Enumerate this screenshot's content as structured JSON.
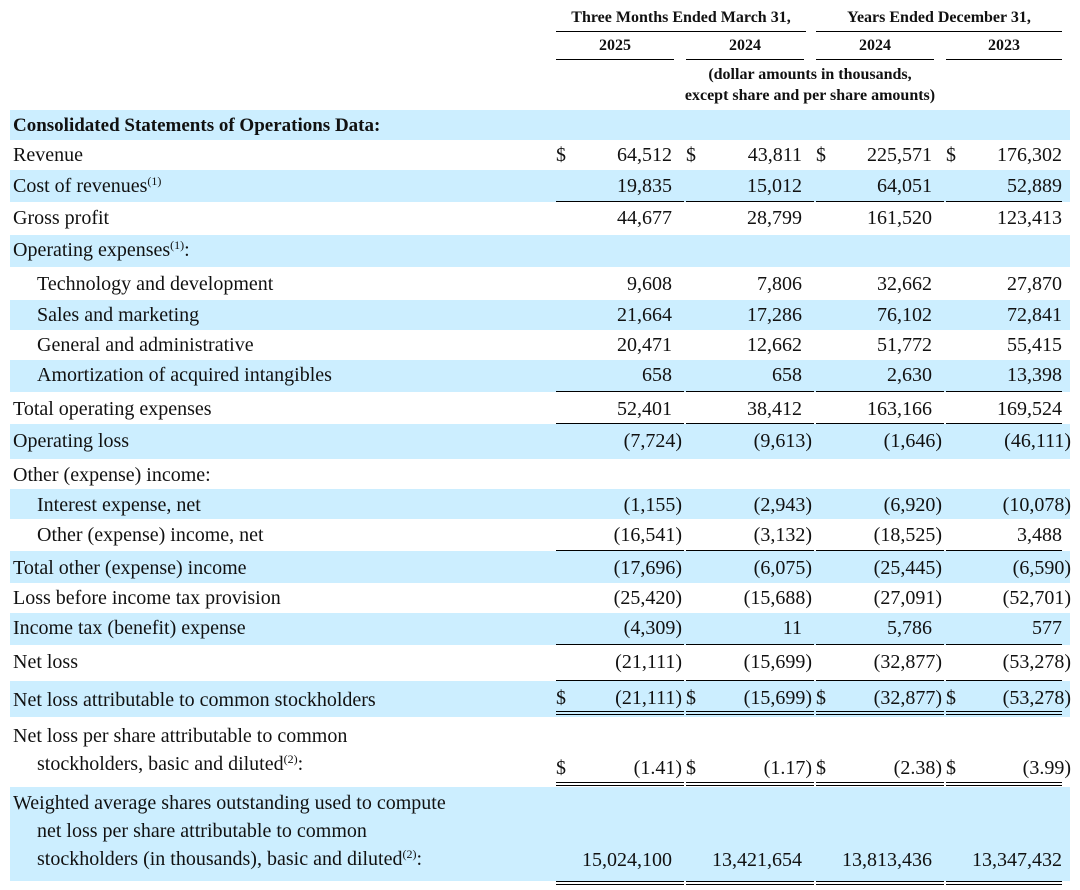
{
  "header": {
    "group1": "Three Months Ended March 31,",
    "group2": "Years Ended December 31,",
    "years": [
      "2025",
      "2024",
      "2024",
      "2023"
    ],
    "note_line1": "(dollar amounts in thousands,",
    "note_line2": "except share and per share amounts)"
  },
  "section_title": "Consolidated Statements of Operations Data:",
  "currency_symbol": "$",
  "footnotes": {
    "one": "(1)",
    "two": "(2)"
  },
  "rows": {
    "revenue": {
      "label": "Revenue",
      "values": [
        "64,512",
        "43,811",
        "225,571",
        "176,302"
      ]
    },
    "cost_of_revenues": {
      "label": "Cost of revenues",
      "values": [
        "19,835",
        "15,012",
        "64,051",
        "52,889"
      ]
    },
    "gross_profit": {
      "label": "Gross profit",
      "values": [
        "44,677",
        "28,799",
        "161,520",
        "123,413"
      ]
    },
    "operating_expenses": {
      "label": "Operating expenses",
      "suffix": ":"
    },
    "tech_dev": {
      "label": "Technology and development",
      "values": [
        "9,608",
        "7,806",
        "32,662",
        "27,870"
      ]
    },
    "sales_marketing": {
      "label": "Sales and marketing",
      "values": [
        "21,664",
        "17,286",
        "76,102",
        "72,841"
      ]
    },
    "general_admin": {
      "label": "General and administrative",
      "values": [
        "20,471",
        "12,662",
        "51,772",
        "55,415"
      ]
    },
    "amortization": {
      "label": "Amortization of acquired intangibles",
      "values": [
        "658",
        "658",
        "2,630",
        "13,398"
      ]
    },
    "total_opex": {
      "label": "Total operating expenses",
      "values": [
        "52,401",
        "38,412",
        "163,166",
        "169,524"
      ]
    },
    "operating_loss": {
      "label": "Operating loss",
      "values": [
        "(7,724)",
        "(9,613)",
        "(1,646)",
        "(46,111)"
      ]
    },
    "other_income": {
      "label": "Other (expense) income:"
    },
    "interest_expense": {
      "label": "Interest expense, net",
      "values": [
        "(1,155)",
        "(2,943)",
        "(6,920)",
        "(10,078)"
      ]
    },
    "other_exp_income": {
      "label": "Other (expense) income, net",
      "values": [
        "(16,541)",
        "(3,132)",
        "(18,525)",
        "3,488"
      ]
    },
    "total_other": {
      "label": "Total other (expense) income",
      "values": [
        "(17,696)",
        "(6,075)",
        "(25,445)",
        "(6,590)"
      ]
    },
    "loss_before_tax": {
      "label": "Loss before income tax provision",
      "values": [
        "(25,420)",
        "(15,688)",
        "(27,091)",
        "(52,701)"
      ]
    },
    "income_tax": {
      "label": "Income tax (benefit) expense",
      "values": [
        "(4,309)",
        "11",
        "5,786",
        "577"
      ]
    },
    "net_loss": {
      "label": "Net loss",
      "values": [
        "(21,111)",
        "(15,699)",
        "(32,877)",
        "(53,278)"
      ]
    },
    "net_loss_common": {
      "label": "Net loss attributable to common stockholders",
      "values": [
        "(21,111)",
        "(15,699)",
        "(32,877)",
        "(53,278)"
      ]
    },
    "net_loss_per_share": {
      "line1": "Net loss per share attributable to common",
      "line2": "stockholders, basic and diluted",
      "suffix": ":",
      "values": [
        "(1.41)",
        "(1.17)",
        "(2.38)",
        "(3.99)"
      ]
    },
    "weighted_shares": {
      "line1": "Weighted average shares outstanding used to compute",
      "line2": "net loss per share attributable to common",
      "line3": "stockholders (in thousands), basic and diluted",
      "suffix": ":",
      "values": [
        "15,024,100",
        "13,421,654",
        "13,813,436",
        "13,347,432"
      ]
    }
  }
}
